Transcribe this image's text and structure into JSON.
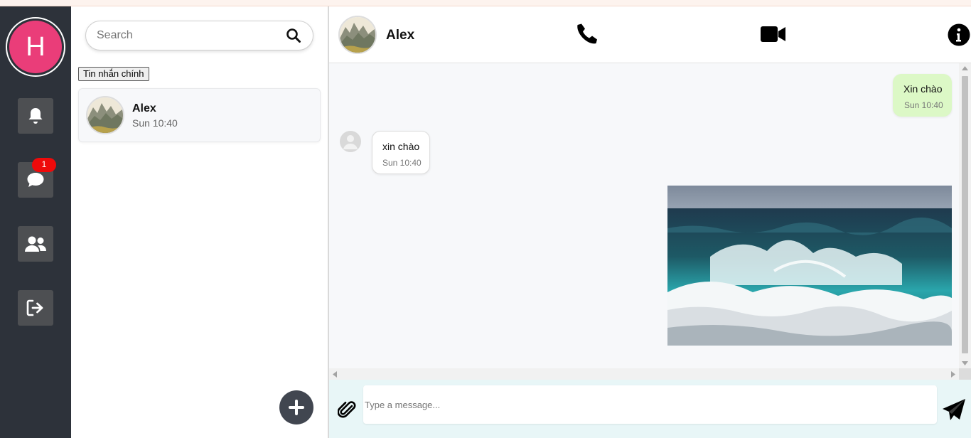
{
  "sidebar": {
    "avatar_letter": "H",
    "avatar_color": "#ea3d79",
    "items": [
      {
        "icon": "bell-icon",
        "label": "Notifications"
      },
      {
        "icon": "chat-bubble-icon",
        "label": "Messages",
        "badge": "1"
      },
      {
        "icon": "users-icon",
        "label": "Friends"
      },
      {
        "icon": "logout-icon",
        "label": "Logout"
      }
    ]
  },
  "conversations": {
    "search_placeholder": "Search",
    "tab_label": "Tin nhắn chính",
    "items": [
      {
        "name": "Alex",
        "time": "Sun 10:40"
      }
    ]
  },
  "chat": {
    "contact_name": "Alex",
    "header_icons": [
      "phone-icon",
      "video-camera-icon",
      "info-icon"
    ],
    "messages": [
      {
        "direction": "out",
        "text": "Xin chào",
        "time": "Sun 10:40"
      },
      {
        "direction": "in",
        "text": "xin chào",
        "time": "Sun 10:40"
      },
      {
        "direction": "out",
        "type": "image",
        "image": "ocean-wave-photo"
      }
    ],
    "composer_placeholder": "Type a message..."
  },
  "colors": {
    "rail_bg": "#2d323a",
    "out_bubble": "#dcf8c6",
    "badge": "#ee0a0a",
    "composer_bg": "#e8f6f7"
  }
}
